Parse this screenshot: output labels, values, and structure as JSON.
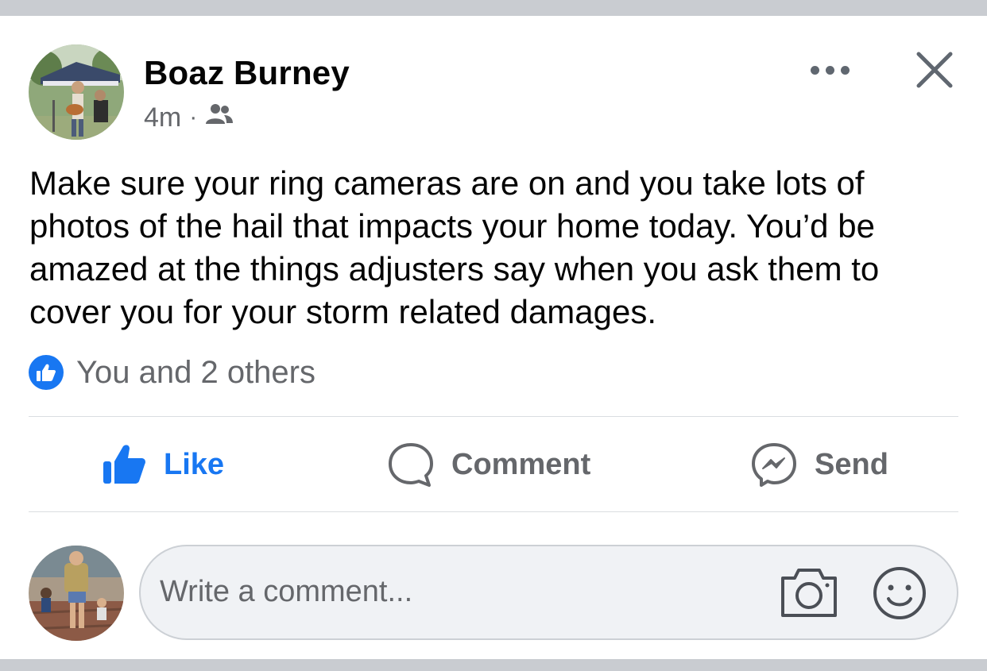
{
  "post": {
    "author_name": "Boaz Burney",
    "timestamp": "4m",
    "separator": "·",
    "audience_icon": "friends-icon",
    "text": "Make sure your ring cameras are on and you take lots of photos of the hail that impacts your home today. You’d be amazed at the things adjusters say when you ask them to cover you for your storm related damages.",
    "reactions_text": "You and 2 others"
  },
  "actions": {
    "like_label": "Like",
    "comment_label": "Comment",
    "send_label": "Send"
  },
  "comment_composer": {
    "placeholder": "Write a comment..."
  },
  "colors": {
    "brand_blue": "#1877f2",
    "secondary_text": "#65676b",
    "primary_text": "#050505",
    "input_background": "#f0f2f5"
  }
}
